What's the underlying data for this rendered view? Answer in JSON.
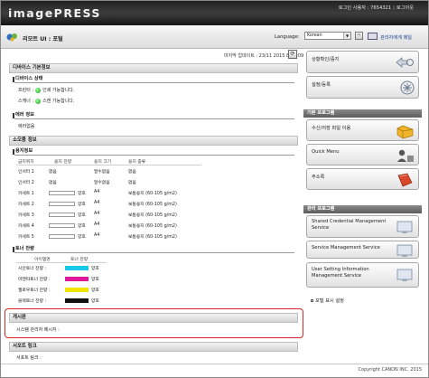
{
  "header": {
    "logo": "imagePRESS",
    "login_user_label": "로그인 사용자 : 7654321",
    "logout_label": "로그아웃"
  },
  "titlebar": {
    "title": "리모트 UI : 포털",
    "language_label": "Language:",
    "language_value": "Korean",
    "go_label": "⇨",
    "admin_mail_link": "관리자에게 메일"
  },
  "status": {
    "last_update": "마지막 업데이트 : 23/11 2015 8:32:09"
  },
  "device": {
    "section_title": "디바이스 기본정보",
    "status_head": "디바이스 상태",
    "printer_label": "프린터 :",
    "printer_status": "인쇄 가능합니다.",
    "scanner_label": "스캐너 :",
    "scanner_status": "스캔 가능합니다.",
    "error_head": "에러 정보",
    "error_text": "에러없음"
  },
  "consumables": {
    "section_title": "소모품 정보",
    "paper_head": "용지정보",
    "headers": [
      "급지위치",
      "용지 잔량",
      "용지 크기",
      "용지 종류"
    ],
    "rows": [
      {
        "loc": "인서터 1",
        "remain": "없음",
        "size": "알수없음",
        "type": "없음",
        "gauge": false
      },
      {
        "loc": "인서터 2",
        "remain": "없음",
        "size": "알수없음",
        "type": "없음",
        "gauge": false
      },
      {
        "loc": "카세트 1",
        "remain": "양호",
        "size": "A4",
        "type": "보통용지 (60-105 g/m2)",
        "gauge": true
      },
      {
        "loc": "카세트 2",
        "remain": "양호",
        "size": "A4",
        "type": "보통용지 (60-105 g/m2)",
        "gauge": true
      },
      {
        "loc": "카세트 3",
        "remain": "양호",
        "size": "A4",
        "type": "보통용지 (60-105 g/m2)",
        "gauge": true
      },
      {
        "loc": "카세트 4",
        "remain": "양호",
        "size": "A4",
        "type": "보통용지 (60-105 g/m2)",
        "gauge": true
      },
      {
        "loc": "카세트 5",
        "remain": "양호",
        "size": "A4",
        "type": "보통용지 (60-105 g/m2)",
        "gauge": true
      }
    ],
    "toner_head": "토너 잔량",
    "toner_headers": [
      "아이템명",
      "토너 잔량"
    ],
    "toners": [
      {
        "name": "시안토너 잔량 :",
        "status": "양호",
        "color": "#18c8e8"
      },
      {
        "name": "마젠타토너 잔량 :",
        "status": "양호",
        "color": "#e0189a"
      },
      {
        "name": "옐로우토너 잔량 :",
        "status": "양호",
        "color": "#f2e600"
      },
      {
        "name": "블랙토너 잔량 :",
        "status": "양호",
        "color": "#111111"
      }
    ]
  },
  "board": {
    "section_title": "게시판",
    "sysadmin_label": "시스템 관리자 메시지 :"
  },
  "support": {
    "section_title": "서포트 링크",
    "support_label": "서포트 링크 :"
  },
  "right": {
    "btn_status": "상황확인/중지",
    "btn_settings": "설정/등록",
    "basic_head": "기본 프로그램",
    "btn_files": "수신/저장 파일 이용",
    "btn_quick": "Quick Menu",
    "btn_address": "주소록",
    "mgmt_head": "관리 프로그램",
    "btn_sc": "Shared Credential Management Service",
    "btn_sms": "Service Management Service",
    "btn_us": "User Setting Information Management Service",
    "portal_display_link": "포털 표시 설정"
  },
  "footer": {
    "copyright": "Copyright CANON INC. 2015"
  }
}
